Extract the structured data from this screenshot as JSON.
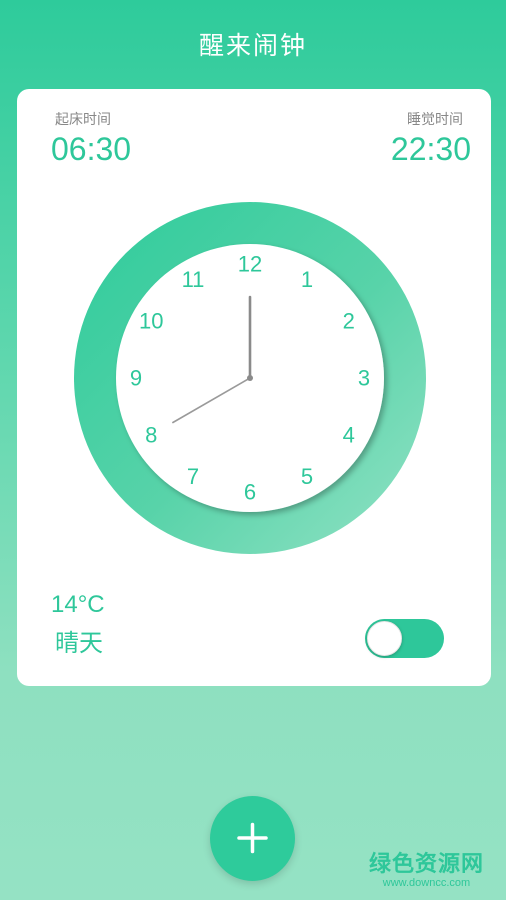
{
  "header": {
    "title": "醒来闹钟"
  },
  "alarm": {
    "wake_label": "起床时间",
    "wake_time": "06:30",
    "sleep_label": "睡觉时间",
    "sleep_time": "22:30"
  },
  "clock": {
    "numerals": [
      "12",
      "1",
      "2",
      "3",
      "4",
      "5",
      "6",
      "7",
      "8",
      "9",
      "10",
      "11"
    ],
    "hour": 8,
    "minute": 0,
    "accent_color": "#2ec79a"
  },
  "weather": {
    "temperature": "14°C",
    "condition": "晴天"
  },
  "toggle": {
    "state": "on"
  },
  "fab": {
    "icon": "plus-icon"
  },
  "watermark": {
    "main": "绿色资源网",
    "sub": "www.downcc.com"
  },
  "colors": {
    "primary": "#2ecb9b",
    "text_accent": "#2ec79a",
    "label_gray": "#888888"
  }
}
